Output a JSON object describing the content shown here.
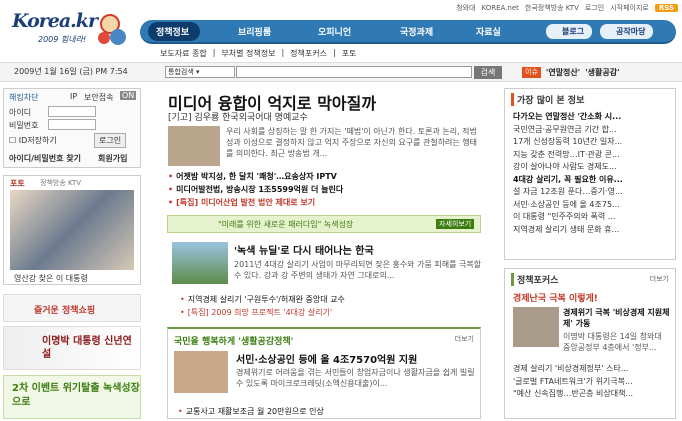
{
  "brand": {
    "logo": "Korea.kr",
    "slogan": "2009 힘내라!"
  },
  "top_links": [
    "청와대",
    "KOREA.net",
    "한국정책방송 KTV",
    "로그인",
    "시작페이지로"
  ],
  "rss_label": "RSS",
  "gnb": {
    "items": [
      "정책정보",
      "브리핑룸",
      "오피니언",
      "국정과제",
      "자료실"
    ],
    "blog": "블로그",
    "gongjak": "공작마당"
  },
  "subnav": [
    "보도자료 종합",
    "부처별 정책정보",
    "정책포커스",
    "포토"
  ],
  "date": "2009년 1월 16일 (금) PM 7:54",
  "search": {
    "select": "통합검색",
    "button": "검색"
  },
  "hot_keywords": {
    "tag": "이슈",
    "items": [
      "'연말정산'",
      "'생활공감'"
    ]
  },
  "login": {
    "secure": "해킹차단",
    "ip": "IP",
    "ip_security": "보안접속",
    "ip_on": "ON",
    "id": "아이디",
    "pw": "비밀번호",
    "save_id": "ID저장하기",
    "login_btn": "로그인",
    "find": "아이디/비밀번호 찾기",
    "join": "회원가입"
  },
  "photo": {
    "title": "포토",
    "source": "정책방송 KTV",
    "caption": "영산강 찾은 이 대통령"
  },
  "promos": [
    "즐거운 정책쇼핑",
    "이명박 대통령 신년연설",
    "2차 이벤트 위기탈출 녹색성장으로"
  ],
  "headline": {
    "title": "미디어 융합이 억지로 막아질까",
    "byline": "[기고] 김우룡 한국외국어대 명예교수",
    "lede": "우리 사회를 상징하는 말 한 가지는 '떼법'이 아닌가 한다. 토론과 논리, 적법성과 이성으로 결정하지 않고 억지 주장으로 자신의 요구를 관철하려는 행태를 의미한다. 최근 방송법 개...",
    "bullets": [
      "어젯밤 박지성, 한 달치 '쾌청'…요송상자 IPTV",
      "미디어발전법, 방송시장 1조5599억원 더 늘린다",
      "[특집] 미디어산업 발전 법안 제대로 보기"
    ]
  },
  "green": {
    "banner": "\"미래를 위한 새로운 패러다임\" 녹색성장",
    "banner_btn": "자세히보기",
    "title": "'녹색 뉴딜'로 다시 태어나는 한국",
    "lede": "2011년 4대강 살리기 사업이 마무리되면 잦은 홍수와 가뭄 피해를 극복할 수 있다. 강과 강 주변의 생태가 자연 그대로의...",
    "bullets": [
      "지역경제 살리기 '구원투수'/허재완 중앙대 교수",
      "[특집] 2009 희망 프로젝트 '4대강 살리기'"
    ]
  },
  "people": {
    "heading": "국민을 행복하게 '생활공감정책'",
    "more": "더보기",
    "title": "서민·소상공인 등에 올 4조7570억원 지원",
    "lede": "경제위기로 어려움을 겪는 서민들이 창업자금이나 생활자금을 쉽게 빌릴 수 있도록 마이크로크레딧(소액신용대출)이...",
    "bullet": "교통사고 재활보조금 월 20만원으로 인상"
  },
  "popular": {
    "title": "가장 많이 본 정보",
    "items": [
      "다가오는 연말정산 '간소화 시...",
      "국민연금·공무원연금 기간 합...",
      "17개 신성장동력 10년간 일자...",
      "지능 갖춘 전력망…IT·관광 콘...",
      "강이 살아나야 사람도 경제도...",
      "4대강 살리기, 꼭 필요한 이유...",
      "설 자금 12조원 푼다…중기·영...",
      "서민·소상공인 등에 올 4조75...",
      "이 대통령 \"민주주의와 폭력 ...",
      "지역경제 살리기 생태 문화 휴..."
    ]
  },
  "focus": {
    "title": "정책포커스",
    "more": "더보기",
    "headline": "경제난국 극복 이렇게!",
    "sub": "경제위기 극복 '비상경제 지원체제' 가동",
    "lede": "이명박 대통령은 14일 청와대 중앙공정부 4층에서 '정부...",
    "items": [
      "경제 살리기 '비상경제정부' 스타...",
      "'글로벌 FTA네트워크'가 위기극복...",
      "\"예산 신속집행…반곤층 비상대책..."
    ]
  }
}
